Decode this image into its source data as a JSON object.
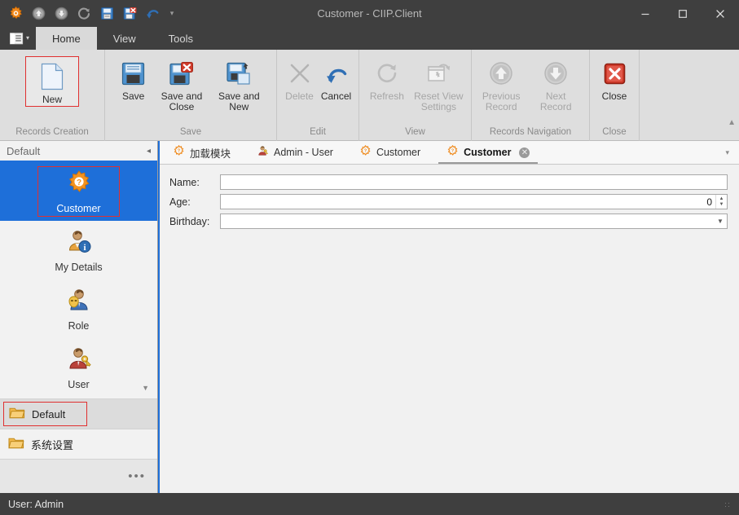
{
  "window": {
    "title": "Customer - CIIP.Client",
    "minimize_label": "Minimize",
    "maximize_label": "Maximize",
    "close_label": "Close"
  },
  "quick_access": {
    "items": [
      {
        "name": "app-gear-icon",
        "label": "Application Menu"
      },
      {
        "name": "arrow-up-icon",
        "label": "Previous Record"
      },
      {
        "name": "arrow-down-icon",
        "label": "Next Record"
      },
      {
        "name": "refresh-icon",
        "label": "Refresh"
      },
      {
        "name": "save-icon",
        "label": "Save"
      },
      {
        "name": "save-and-close-icon",
        "label": "Save and Close"
      },
      {
        "name": "undo-icon",
        "label": "Undo"
      }
    ],
    "overflow_label": "▾"
  },
  "ribbon": {
    "app_button_label": "▾",
    "tabs": [
      {
        "label": "Home",
        "active": true
      },
      {
        "label": "View",
        "active": false
      },
      {
        "label": "Tools",
        "active": false
      }
    ],
    "collapse_label": "▲",
    "groups": [
      {
        "label": "Records Creation",
        "buttons": [
          {
            "label": "New",
            "icon": "new-document-icon",
            "disabled": false,
            "selected": true
          }
        ]
      },
      {
        "label": "Save",
        "buttons": [
          {
            "label": "Save",
            "icon": "floppy-disk-icon",
            "disabled": false,
            "selected": false
          },
          {
            "label": "Save and Close",
            "icon": "floppy-disk-close-icon",
            "disabled": false,
            "selected": false
          },
          {
            "label": "Save and New",
            "icon": "floppy-disk-new-icon",
            "disabled": false,
            "selected": false
          }
        ]
      },
      {
        "label": "Edit",
        "buttons": [
          {
            "label": "Delete",
            "icon": "x-cross-icon",
            "disabled": true,
            "selected": false
          },
          {
            "label": "Cancel",
            "icon": "undo-arrow-icon",
            "disabled": false,
            "selected": false
          }
        ]
      },
      {
        "label": "View",
        "buttons": [
          {
            "label": "Refresh",
            "icon": "refresh-circular-icon",
            "disabled": true,
            "selected": false
          },
          {
            "label": "Reset View Settings",
            "icon": "reset-view-icon",
            "disabled": true,
            "selected": false
          }
        ]
      },
      {
        "label": "Records Navigation",
        "buttons": [
          {
            "label": "Previous Record",
            "icon": "circle-arrow-up-icon",
            "disabled": true,
            "selected": false
          },
          {
            "label": "Next Record",
            "icon": "circle-arrow-down-icon",
            "disabled": true,
            "selected": false
          }
        ]
      },
      {
        "label": "Close",
        "buttons": [
          {
            "label": "Close",
            "icon": "red-x-close-icon",
            "disabled": false,
            "selected": false
          }
        ]
      }
    ]
  },
  "navpane": {
    "header": {
      "title": "Default",
      "collapse_icon": "chevron-left-icon"
    },
    "items": [
      {
        "label": "Customer",
        "icon": "orange-gear-question-icon",
        "active": true
      },
      {
        "label": "My Details",
        "icon": "user-info-icon",
        "active": false
      },
      {
        "label": "Role",
        "icon": "user-mask-icon",
        "active": false
      },
      {
        "label": "User",
        "icon": "user-key-icon",
        "active": false
      }
    ],
    "scroll_down_icon": "chevron-down-icon",
    "groups": [
      {
        "label": "Default",
        "icon": "folder-icon",
        "active": true
      },
      {
        "label": "系统设置",
        "icon": "folder-icon",
        "active": false
      }
    ],
    "overflow_label": "•••"
  },
  "document_tabs": {
    "tabs": [
      {
        "label": "加载模块",
        "icon": "orange-gear-question-icon",
        "active": false,
        "closable": false
      },
      {
        "label": "Admin - User",
        "icon": "user-key-icon",
        "active": false,
        "closable": false
      },
      {
        "label": "Customer",
        "icon": "orange-gear-question-icon",
        "active": false,
        "closable": false
      },
      {
        "label": "Customer",
        "icon": "orange-gear-question-icon",
        "active": true,
        "closable": true
      }
    ],
    "close_glyph": "✕",
    "overflow_label": "▾"
  },
  "form": {
    "fields": [
      {
        "label": "Name:",
        "value": "",
        "placeholder": "",
        "type": "text"
      },
      {
        "label": "Age:",
        "value": "0",
        "placeholder": "",
        "type": "spinner"
      },
      {
        "label": "Birthday:",
        "value": "",
        "placeholder": "",
        "type": "dropdown"
      }
    ]
  },
  "statusbar": {
    "text": "User: Admin"
  },
  "colors": {
    "titlebar": "#3f3f3f",
    "ribbon": "#dedede",
    "accent_blue": "#1e6fd9",
    "selection_red": "#e03030",
    "orange_gear": "#f08a1e"
  }
}
